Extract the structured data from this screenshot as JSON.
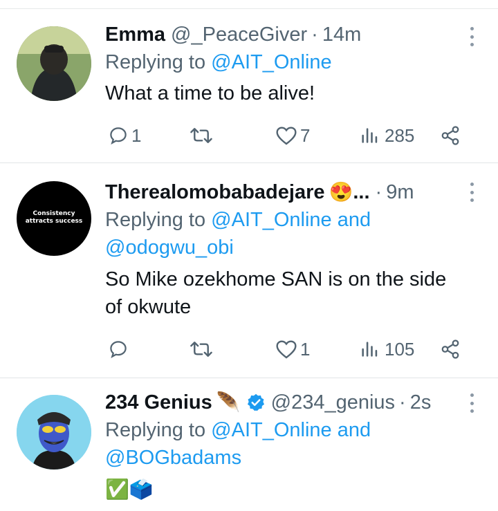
{
  "tweets": [
    {
      "name": "Emma",
      "handle": "@_PeaceGiver",
      "dot": "·",
      "time": "14m",
      "replying_prefix": "Replying to ",
      "mentions_line1": "@AIT_Online",
      "mentions_line2": "",
      "text_line1": "What a time to be alive!",
      "text_line2": "",
      "replies": "1",
      "retweets": "",
      "likes": "7",
      "views": "285"
    },
    {
      "name": "Therealomobabadejare",
      "emoji": "😍",
      "ellipsis": "...",
      "dot": "·",
      "time": "9m",
      "replying_prefix": "Replying to ",
      "mentions_line1": "@AIT_Online and",
      "mentions_line2": "@odogwu_obi",
      "text_line1": "So Mike ozekhome SAN is on the side",
      "text_line2": "of okwute",
      "avatar_text_1": "Consistency",
      "avatar_text_2": "attracts success",
      "replies": "",
      "retweets": "",
      "likes": "1",
      "views": "105"
    },
    {
      "name": "234 Genius",
      "emoji": "🪶",
      "handle": "@234_genius",
      "dot": "·",
      "time": "2s",
      "replying_prefix": "Replying to ",
      "mentions_line1": "@AIT_Online and",
      "mentions_line2": "@BOGbadams",
      "text_line1": "✅🗳️"
    }
  ],
  "colors": {
    "link": "#1d9bf0",
    "secondary_text": "#536471",
    "primary_text": "#0f1419",
    "verified": "#1d9bf0"
  },
  "icons": [
    "reply-icon",
    "retweet-icon",
    "like-icon",
    "views-icon",
    "share-icon",
    "more-icon",
    "verified-badge-icon"
  ]
}
